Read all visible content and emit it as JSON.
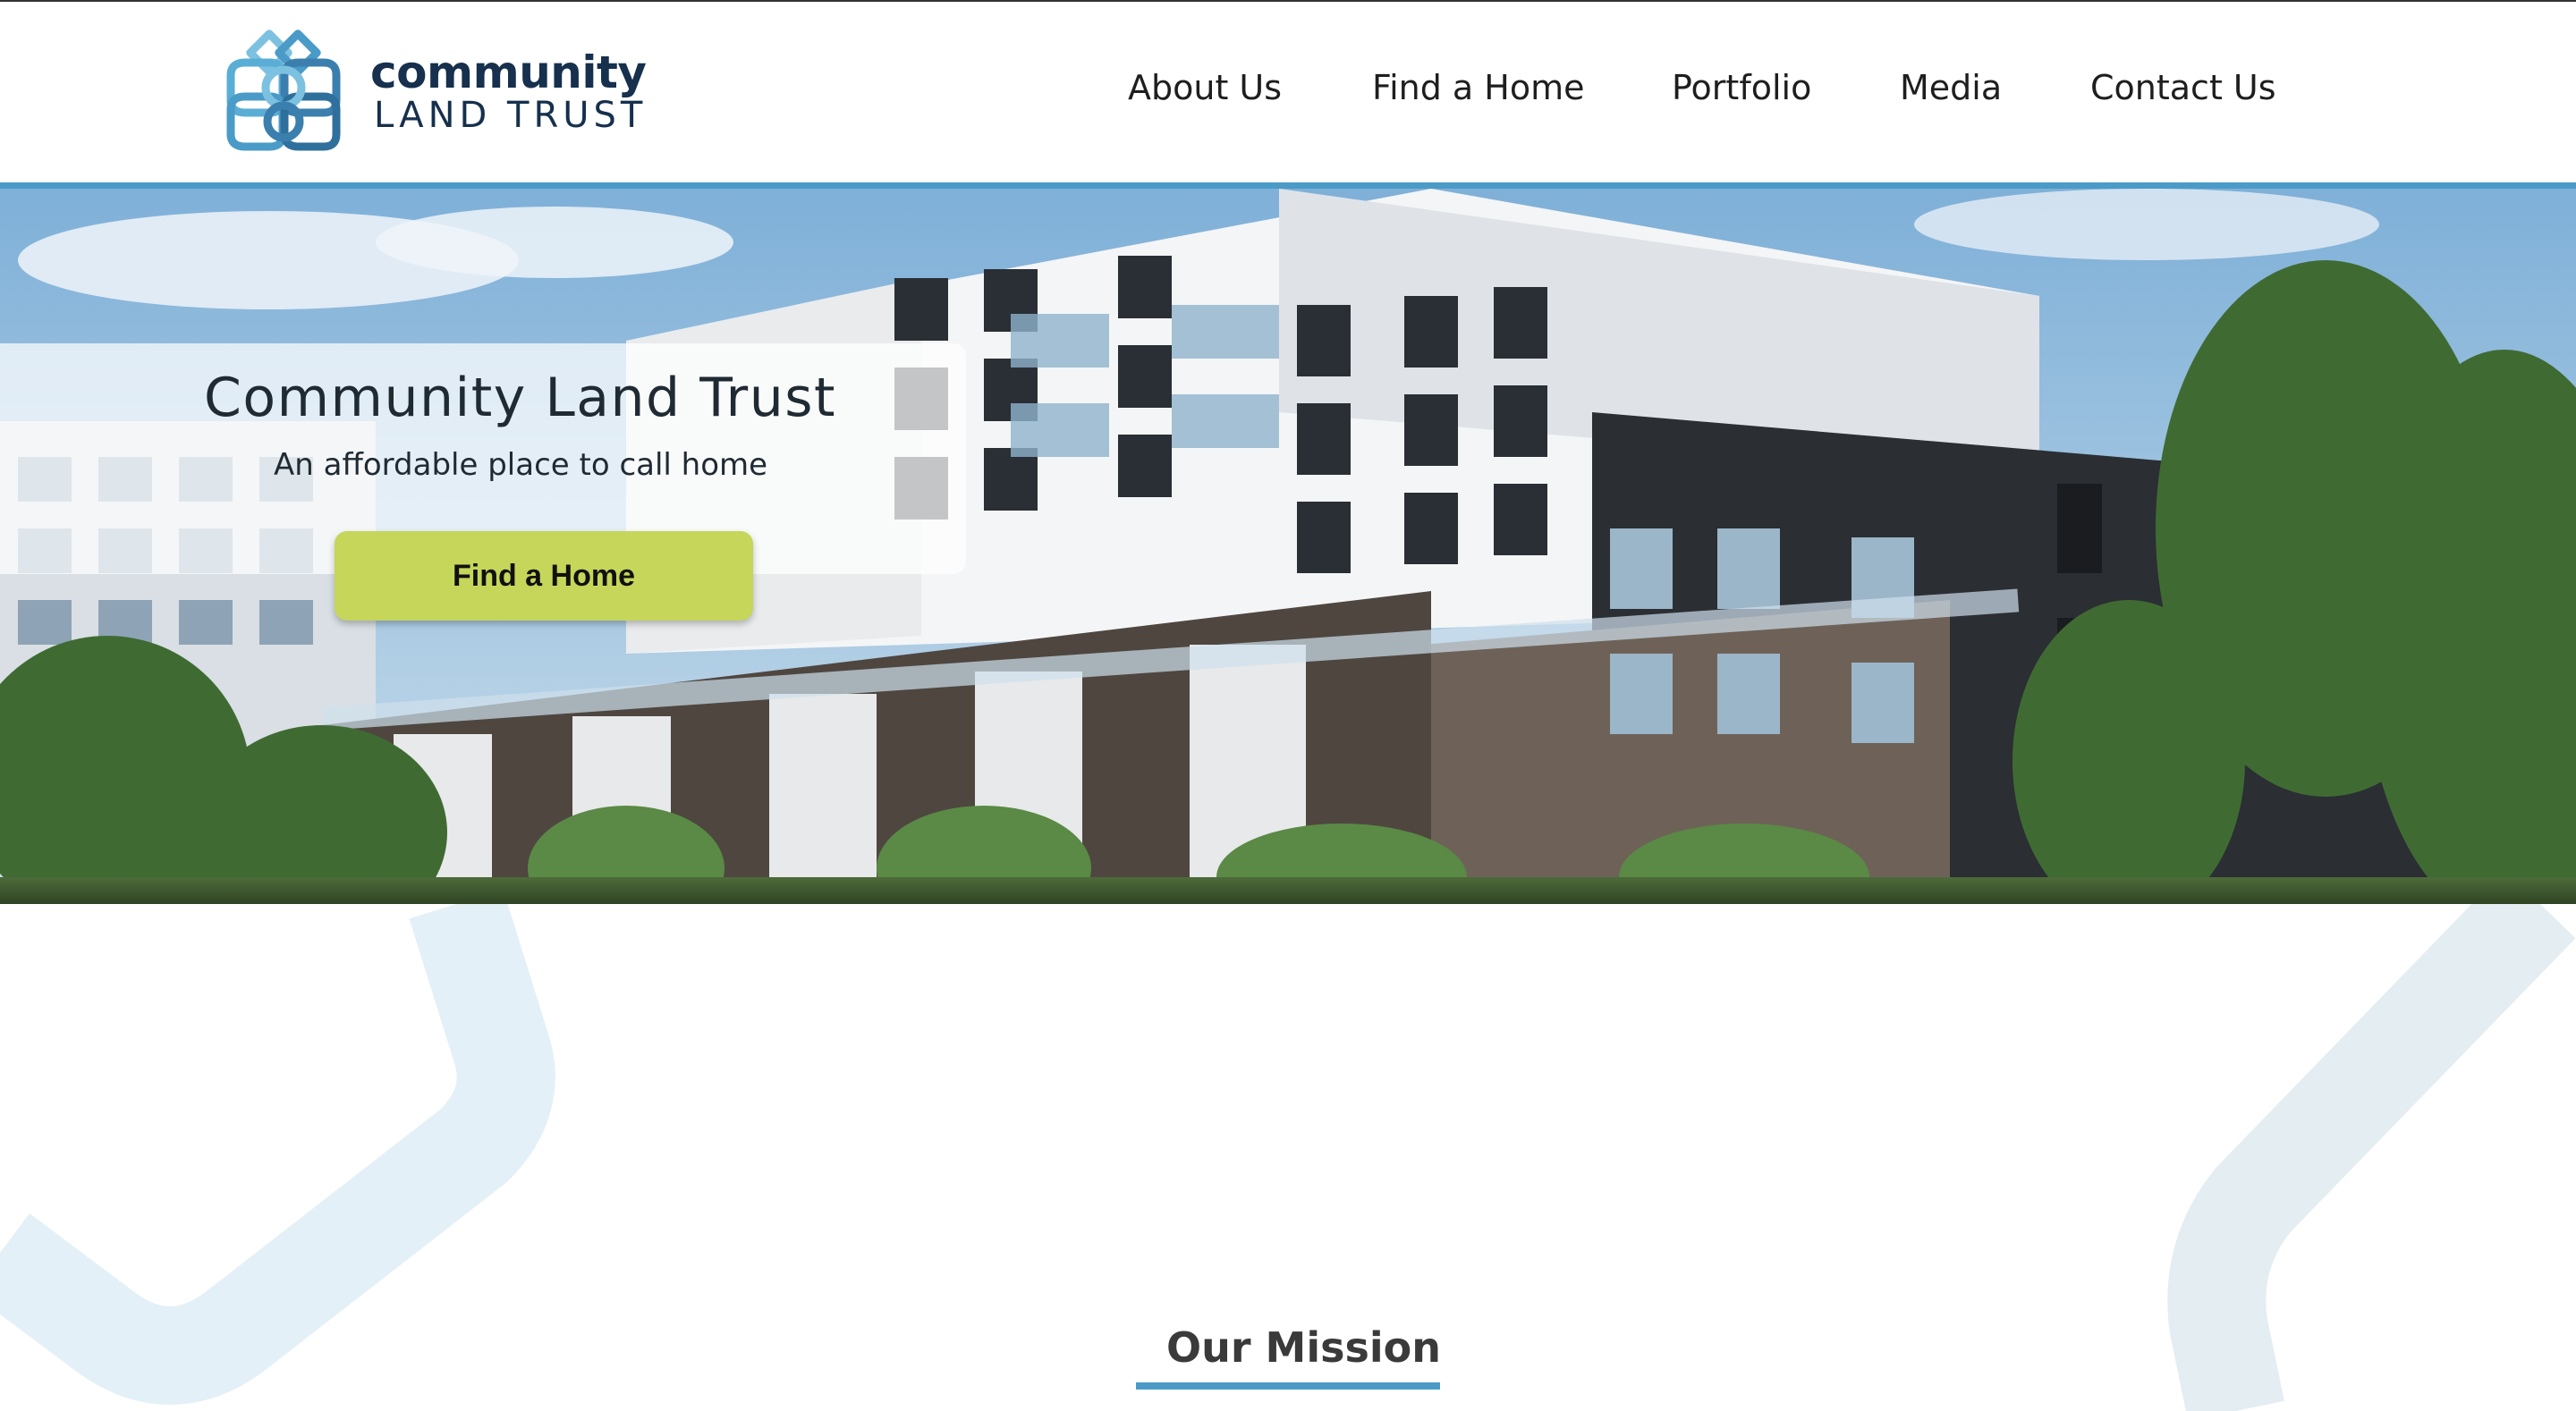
{
  "brand": {
    "line1": "community",
    "line2": "LAND TRUST",
    "logo_icon": "interlocking-knot-logo-icon",
    "color_dark": "#16304d",
    "color_accent": "#4a9bc7"
  },
  "nav": {
    "items": [
      {
        "label": "About Us"
      },
      {
        "label": "Find a Home"
      },
      {
        "label": "Portfolio"
      },
      {
        "label": "Media"
      },
      {
        "label": "Contact Us"
      }
    ]
  },
  "hero": {
    "title": "Community Land Trust",
    "subtitle": "An affordable place to call home",
    "button_label": "Find a Home",
    "button_color": "#c6d65a"
  },
  "mission": {
    "heading": "Our Mission"
  }
}
